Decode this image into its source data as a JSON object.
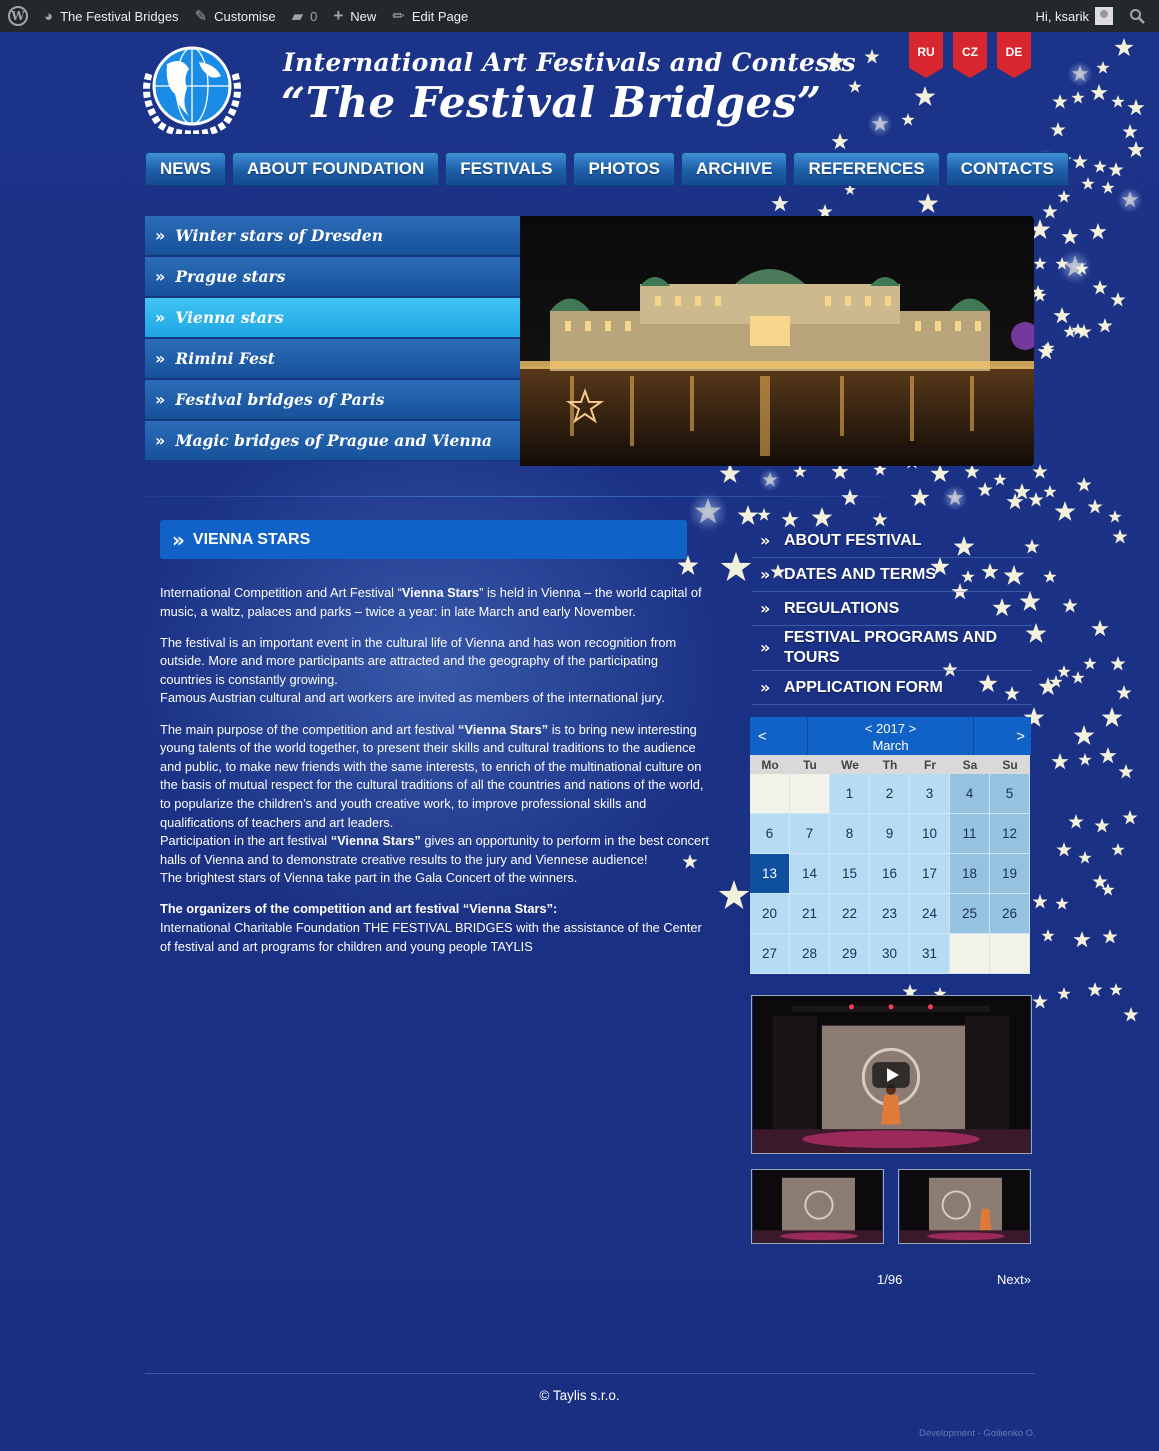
{
  "adminbar": {
    "site_name": "The Festival Bridges",
    "customise": "Customise",
    "comments_count": "0",
    "new": "New",
    "edit_page": "Edit Page",
    "greeting": "Hi, ksarik"
  },
  "header": {
    "subtitle": "International Art Festivals and Contests",
    "title": "“The Festival Bridges”",
    "languages": [
      "RU",
      "CZ",
      "DE"
    ]
  },
  "nav": [
    "NEWS",
    "ABOUT FOUNDATION",
    "FESTIVALS",
    "PHOTOS",
    "ARCHIVE",
    "REFERENCES",
    "CONTACTS"
  ],
  "festivals": [
    {
      "label": "Winter stars of Dresden",
      "active": false
    },
    {
      "label": "Prague stars",
      "active": false
    },
    {
      "label": "Vienna stars",
      "active": true
    },
    {
      "label": "Rimini Fest",
      "active": false
    },
    {
      "label": "Festival bridges of Paris",
      "active": false
    },
    {
      "label": "Magic bridges of Prague and Vienna",
      "active": false
    }
  ],
  "page": {
    "heading": "VIENNA STARS",
    "p1_a": "International Competition and Art Festival “",
    "p1_b": "Vienna Stars",
    "p1_c": "” is held in Vienna – the world capital of music, a waltz, palaces and parks – twice a year: in late March and early November.",
    "p2": "The festival is an important event in the cultural life of Vienna and has won recognition from outside. More and more participants are attracted and the geography of the participating countries is constantly growing.",
    "p2b": "Famous Austrian cultural and art workers are invited as members of the international jury.",
    "p3_a": "The main purpose of the competition and art festival ",
    "p3_b": "“Vienna Stars”",
    "p3_c": " is to bring new interesting young talents of the world together, to present their skills and cultural traditions to the audience and public, to make new friends with the same interests, to enrich of the multinational culture on the basis of mutual respect for the cultural traditions of all the countries and nations of the world, to popularize the children’s and youth creative work, to improve professional skills and qualifications of teachers and art leaders.",
    "p3d_a": "Participation in the art festival ",
    "p3d_b": "“Vienna Stars”",
    "p3d_c": " gives an opportunity to perform in the best concert halls of Vienna and to demonstrate creative results to the jury and Viennese audience!",
    "p3e": "The brightest stars of Vienna take part in the Gala Concert of the winners.",
    "p4_title": "The organizers of the competition and art festival “Vienna Stars”:",
    "p4": "International Charitable Foundation THE FESTIVAL BRIDGES with the assistance of the Center of festival and art programs for children and young people TAYLIS"
  },
  "side_menu": [
    "ABOUT FESTIVAL",
    "DATES AND TERMS",
    "REGULATIONS",
    "FESTIVAL PROGRAMS AND TOURS",
    "APPLICATION FORM"
  ],
  "calendar": {
    "prev": "<",
    "next": ">",
    "year_line": "< 2017 >",
    "month": "March",
    "weekdays": [
      "Mo",
      "Tu",
      "We",
      "Th",
      "Fr",
      "Sa",
      "Su"
    ],
    "leading_blanks": 2,
    "days": 31,
    "today": 13
  },
  "video": {
    "pager": "1/96",
    "next": "Next»"
  },
  "footer": {
    "copyright": "© Taylis s.r.o.",
    "developer": "Development - Goliienko O."
  }
}
